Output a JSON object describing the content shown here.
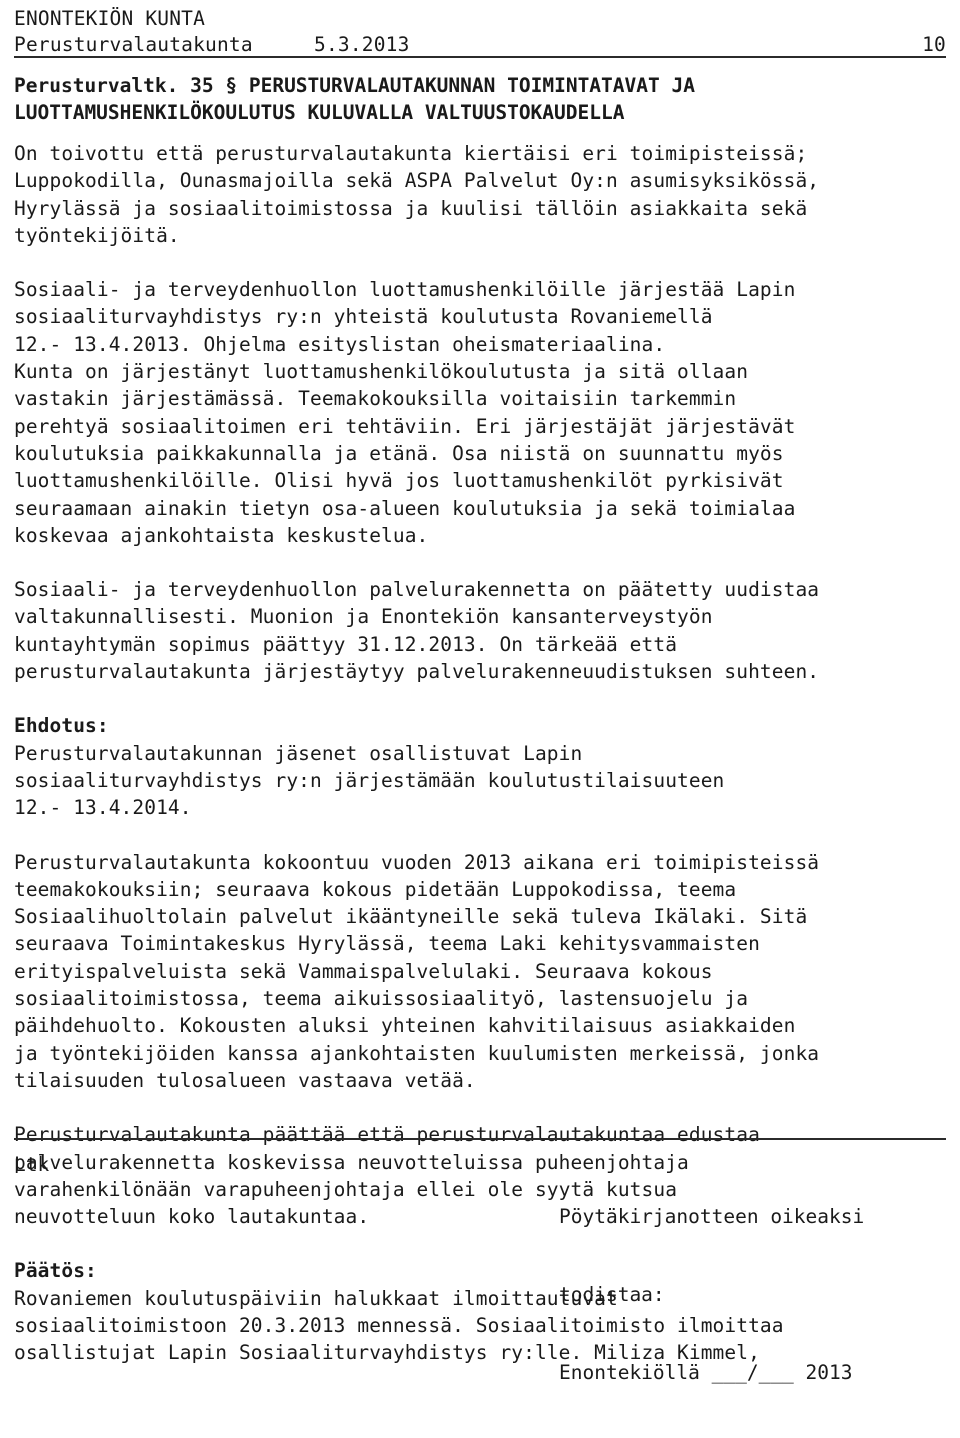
{
  "header": {
    "organization": "ENONTEKIÖN KUNTA",
    "body_name": "Perusturvalautakunta",
    "date": "5.3.2013",
    "page_number": "10"
  },
  "title": {
    "case_label": "Perusturvaltk.",
    "case_number": "35 §",
    "heading_line1": "PERUSTURVALAUTAKUNNAN TOIMINTATAVAT JA",
    "heading_line2": "LUOTTAMUSHENKILÖKOULUTUS KULUVALLA VALTUUSTOKAUDELLA"
  },
  "body": {
    "paragraph1": "On toivottu että perusturvalautakunta kiertäisi eri toimipisteissä;\nLuppokodilla, Ounasmajoilla sekä ASPA Palvelut Oy:n asumisyksikössä,\nHyrylässä ja sosiaalitoimistossa ja kuulisi tällöin asiakkaita sekä\ntyöntekijöitä.",
    "paragraph2": "Sosiaali- ja terveydenhuollon luottamushenkilöille järjestää Lapin\nsosiaaliturvayhdistys ry:n yhteistä koulutusta Rovaniemellä\n12.- 13.4.2013. Ohjelma esityslistan oheismateriaalina.\nKunta on järjestänyt luottamushenkilökoulutusta ja sitä ollaan\nvastakin järjestämässä. Teemakokouksilla voitaisiin tarkemmin\nperehtyä sosiaalitoimen eri tehtäviin. Eri järjestäjät järjestävät\nkoulutuksia paikkakunnalla ja etänä. Osa niistä on suunnattu myös\nluottamushenkilöille. Olisi hyvä jos luottamushenkilöt pyrkisivät\nseuraamaan ainakin tietyn osa-alueen koulutuksia ja sekä toimialaa\nkoskevaa ajankohtaista keskustelua.",
    "paragraph3": "Sosiaali- ja terveydenhuollon palvelurakennetta on päätetty uudistaa\nvaltakunnallisesti. Muonion ja Enontekiön kansanterveystyön\nkuntayhtymän sopimus päättyy 31.12.2013. On tärkeää että\nperusturvalautakunta järjestäytyy palvelurakenneuudistuksen suhteen.",
    "proposal_label": "Ehdotus:",
    "proposal_text": "Perusturvalautakunnan jäsenet osallistuvat Lapin\nsosiaaliturvayhdistys ry:n järjestämään koulutustilaisuuteen\n12.- 13.4.2014.",
    "proposal_text2": "Perusturvalautakunta kokoontuu vuoden 2013 aikana eri toimipisteissä\nteemakokouksiin; seuraava kokous pidetään Luppokodissa, teema\nSosiaalihuoltolain palvelut ikääntyneille sekä tuleva Ikälaki. Sitä\nseuraava Toimintakeskus Hyrylässä, teema Laki kehitysvammaisten\nerityispalveluista sekä Vammaispalvelulaki. Seuraava kokous\nsosiaalitoimistossa, teema aikuissosiaalityö, lastensuojelu ja\npäihdehuolto. Kokousten aluksi yhteinen kahvitilaisuus asiakkaiden\nja työntekijöiden kanssa ajankohtaisten kuulumisten merkeissä, jonka\ntilaisuuden tulosalueen vastaava vetää.",
    "proposal_text3": "Perusturvalautakunta päättää että perusturvalautakuntaa edustaa\npalvelurakennetta koskevissa neuvotteluissa puheenjohtaja\nvarahenkilönään varapuheenjohtaja ellei ole syytä kutsua\nneuvotteluun koko lautakuntaa.",
    "decision_label": "Päätös:",
    "decision_text": "Rovaniemen koulutuspäiviin halukkaat ilmoittautuvat\nsosiaalitoimistoon 20.3.2013 mennessä. Sosiaalitoimisto ilmoittaa\nosallistujat Lapin Sosiaaliturvayhdistys ry:lle. Miliza Kimmel,"
  },
  "footer": {
    "left": "Ltk",
    "right_line1": "Pöytäkirjanotteen oikeaksi",
    "right_line2": "todistaa:",
    "right_line3": "Enontekiöllä ___/___ 2013"
  }
}
